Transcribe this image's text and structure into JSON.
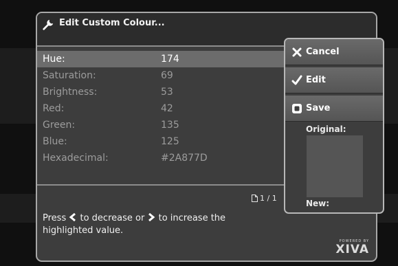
{
  "dialog": {
    "title": "Edit Custom Colour..."
  },
  "fields": [
    {
      "label": "Hue:",
      "value": "174",
      "selected": true
    },
    {
      "label": "Saturation:",
      "value": "69",
      "selected": false
    },
    {
      "label": "Brightness:",
      "value": "53",
      "selected": false
    },
    {
      "label": "Red:",
      "value": "42",
      "selected": false
    },
    {
      "label": "Green:",
      "value": "135",
      "selected": false
    },
    {
      "label": "Blue:",
      "value": "125",
      "selected": false
    },
    {
      "label": "Hexadecimal:",
      "value": "#2A877D",
      "selected": false
    }
  ],
  "page_indicator": "1 / 1",
  "help": {
    "part1": "Press",
    "part2": "to decrease or",
    "part3": "to increase the highlighted value."
  },
  "menu": {
    "cancel": "Cancel",
    "edit": "Edit",
    "save": "Save"
  },
  "swatch": {
    "original_label": "Original:",
    "new_label": "New:"
  },
  "brand": {
    "powered_by": "POWERED BY",
    "name": "XIVA"
  },
  "icons": {
    "title": "wrench-icon",
    "cancel": "x-icon",
    "edit": "checkmark-icon",
    "save": "save-icon",
    "page": "page-icon"
  }
}
